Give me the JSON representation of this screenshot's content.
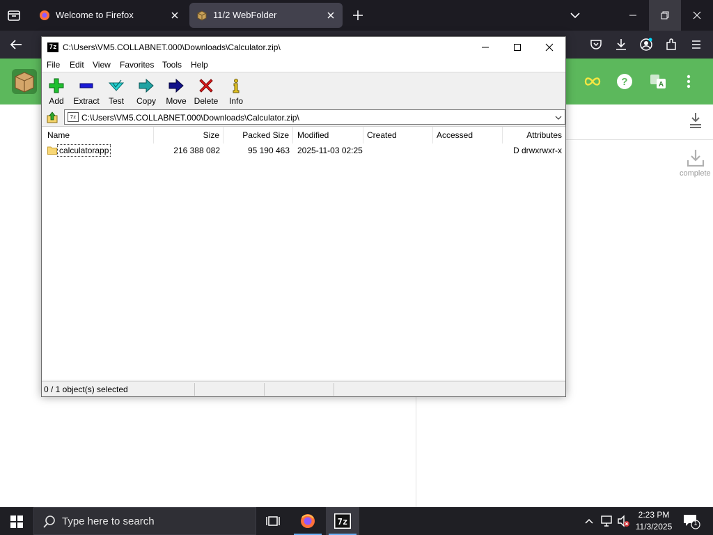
{
  "browser": {
    "tabs": [
      {
        "title": "Welcome to Firefox",
        "active": false
      },
      {
        "title": "11/2 WebFolder",
        "active": true
      }
    ]
  },
  "webpage": {
    "complete_label": "complete"
  },
  "zip": {
    "window_title": "C:\\Users\\VM5.COLLABNET.000\\Downloads\\Calculator.zip\\",
    "app_icon_text": "7z",
    "menu": [
      "File",
      "Edit",
      "View",
      "Favorites",
      "Tools",
      "Help"
    ],
    "toolbar": [
      {
        "label": "Add",
        "icon": "add-icon"
      },
      {
        "label": "Extract",
        "icon": "extract-icon"
      },
      {
        "label": "Test",
        "icon": "test-icon"
      },
      {
        "label": "Copy",
        "icon": "copy-icon"
      },
      {
        "label": "Move",
        "icon": "move-icon"
      },
      {
        "label": "Delete",
        "icon": "delete-icon"
      },
      {
        "label": "Info",
        "icon": "info-icon"
      }
    ],
    "address": "C:\\Users\\VM5.COLLABNET.000\\Downloads\\Calculator.zip\\",
    "columns": [
      "Name",
      "Size",
      "Packed Size",
      "Modified",
      "Created",
      "Accessed",
      "Attributes"
    ],
    "rows": [
      {
        "name": "calculatorapp",
        "size": "216 388 082",
        "packed_size": "95 190 463",
        "modified": "2025-11-03 02:25",
        "created": "",
        "accessed": "",
        "attributes": "D drwxrwxr-x"
      }
    ],
    "status": "0 / 1 object(s) selected"
  },
  "taskbar": {
    "search_placeholder": "Type here to search",
    "time": "2:23 PM",
    "date": "11/3/2025",
    "notification_count": "1"
  },
  "colors": {
    "firefox_dark": "#1c1b22",
    "firefox_active_tab": "#42414d",
    "web_banner_green": "#5cb85c",
    "taskbar_bg": "#1f1f24",
    "accent_blue": "#6ab0f5"
  }
}
